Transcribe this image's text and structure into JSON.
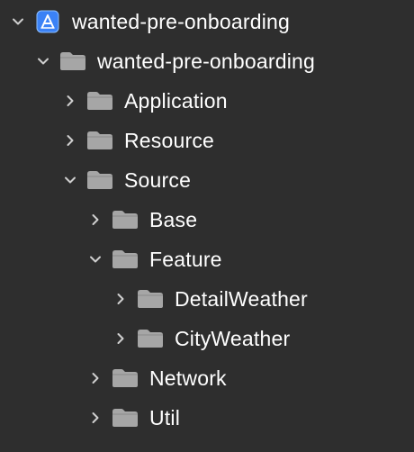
{
  "navigator": {
    "project": {
      "label": "wanted-pre-onboarding",
      "icon": "xcode-project-icon",
      "expanded": true
    },
    "group_root": {
      "label": "wanted-pre-onboarding",
      "icon": "folder-icon",
      "expanded": true
    },
    "group_application": {
      "label": "Application",
      "icon": "folder-icon",
      "expanded": false
    },
    "group_resource": {
      "label": "Resource",
      "icon": "folder-icon",
      "expanded": false
    },
    "group_source": {
      "label": "Source",
      "icon": "folder-icon",
      "expanded": true
    },
    "group_base": {
      "label": "Base",
      "icon": "folder-icon",
      "expanded": false
    },
    "group_feature": {
      "label": "Feature",
      "icon": "folder-icon",
      "expanded": true
    },
    "group_detailweather": {
      "label": "DetailWeather",
      "icon": "folder-icon",
      "expanded": false
    },
    "group_cityweather": {
      "label": "CityWeather",
      "icon": "folder-icon",
      "expanded": false
    },
    "group_network": {
      "label": "Network",
      "icon": "folder-icon",
      "expanded": false
    },
    "group_util": {
      "label": "Util",
      "icon": "folder-icon",
      "expanded": false
    }
  },
  "colors": {
    "background": "#2e2e2e",
    "text": "#ffffff",
    "chevron": "#cfcfcf",
    "folder": "#a6a6a6",
    "project_icon": "#3b82f6"
  }
}
